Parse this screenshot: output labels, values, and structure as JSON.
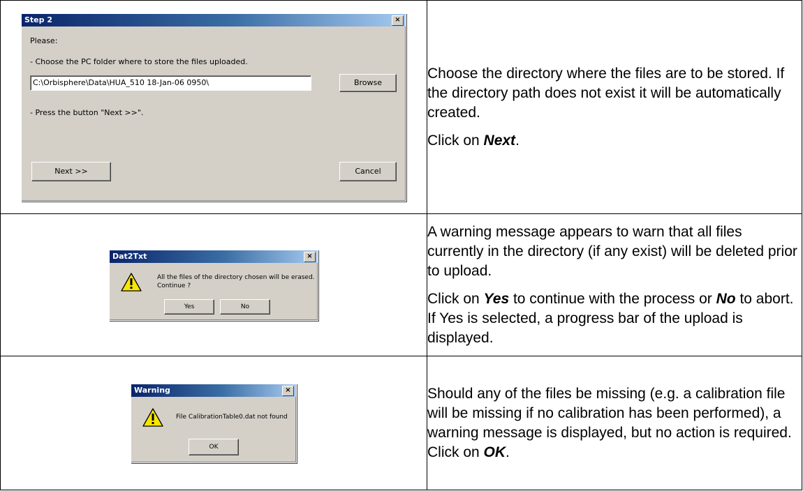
{
  "rows": [
    {
      "dialog": {
        "title": "Step 2",
        "close": "×",
        "please": "Please:",
        "instruction1": "- Choose the PC folder where to store the files uploaded.",
        "path_value": "C:\\Orbisphere\\Data\\HUA_510 18-Jan-06 0950\\",
        "browse_label": "Browse",
        "instruction2": "- Press the button \"Next >>\".",
        "next_label": "Next >>",
        "cancel_label": "Cancel"
      },
      "text": {
        "p1": "Choose the directory where the files are to be stored. If the directory path does not exist it will be automatically created.",
        "p2_pre": "Click on ",
        "p2_bold": "Next",
        "p2_post": "."
      }
    },
    {
      "dialog": {
        "title": "Dat2Txt",
        "close": "×",
        "message_line1": "All the files of the directory chosen will be erased.",
        "message_line2": "Continue ?",
        "yes_label": "Yes",
        "no_label": "No"
      },
      "text": {
        "p1": "A warning message appears to warn that all files currently in the directory (if any exist) will be deleted prior to upload.",
        "p2_pre": "Click on ",
        "p2_bold1": "Yes",
        "p2_mid": " to continue with the process or ",
        "p2_bold2": "No",
        "p2_post": " to abort. If Yes is selected, a progress bar of the upload is displayed."
      }
    },
    {
      "dialog": {
        "title": "Warning",
        "close": "×",
        "message": "File CalibrationTable0.dat not found",
        "ok_label": "OK"
      },
      "text": {
        "p1_pre": "Should any of the files be missing (e.g. a calibration file will be missing if no calibration has been performed), a warning message is displayed, but no action is required. Click on ",
        "p1_bold": "OK",
        "p1_post": "."
      }
    }
  ],
  "colors": {
    "titlebar_start": "#0a246a",
    "titlebar_end": "#a6caf0",
    "dialog_face": "#d4d0c8",
    "warning_yellow": "#f7e600"
  },
  "icons": [
    "close-icon",
    "warning-icon"
  ]
}
